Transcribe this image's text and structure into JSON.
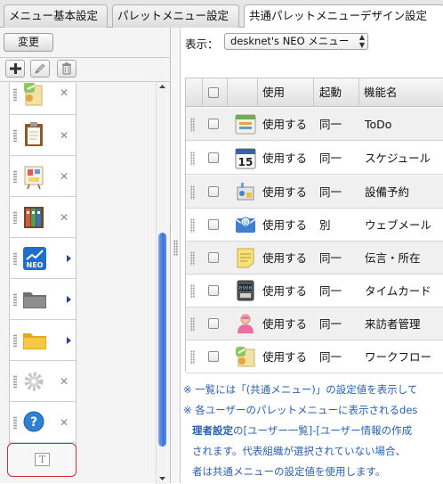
{
  "tabs": [
    {
      "label": "メニュー基本設定",
      "active": false
    },
    {
      "label": "パレットメニュー設定",
      "active": false
    },
    {
      "label": "共通パレットメニューデザイン設定",
      "active": true
    }
  ],
  "left_panel": {
    "change_button": "変更",
    "toolbar_icons": [
      "plus-icon",
      "pencil-icon",
      "trash-icon"
    ],
    "menu_items": [
      {
        "icon": "workflow-icon",
        "trailing": "close"
      },
      {
        "icon": "clipboard-icon",
        "trailing": "close"
      },
      {
        "icon": "bulletin-board-icon",
        "trailing": "close"
      },
      {
        "icon": "binders-icon",
        "trailing": "close"
      },
      {
        "icon": "neo-chart-icon",
        "trailing": "submenu-arrow"
      },
      {
        "icon": "gray-folder-icon",
        "trailing": "submenu-arrow"
      },
      {
        "icon": "yellow-folder-icon",
        "trailing": "submenu-arrow"
      },
      {
        "icon": "gear-icon",
        "trailing": "close"
      },
      {
        "icon": "help-icon",
        "trailing": "close"
      }
    ],
    "text_item_icon": "T"
  },
  "display": {
    "label": "表示：",
    "selected": "desknet's NEO メニュー"
  },
  "table": {
    "headers": {
      "use": "使用",
      "launch": "起動",
      "name": "機能名"
    },
    "rows": [
      {
        "icon": "todo-icon",
        "use": "使用する",
        "launch": "同一",
        "name": "ToDo"
      },
      {
        "icon": "calendar-icon",
        "use": "使用する",
        "launch": "同一",
        "name": "スケジュール"
      },
      {
        "icon": "facility-icon",
        "use": "使用する",
        "launch": "同一",
        "name": "設備予約"
      },
      {
        "icon": "webmail-icon",
        "use": "使用する",
        "launch": "別",
        "name": "ウェブメール"
      },
      {
        "icon": "memo-icon",
        "use": "使用する",
        "launch": "同一",
        "name": "伝言・所在"
      },
      {
        "icon": "timecard-icon",
        "use": "使用する",
        "launch": "同一",
        "name": "タイムカード"
      },
      {
        "icon": "visitor-icon",
        "use": "使用する",
        "launch": "同一",
        "name": "来訪者管理"
      },
      {
        "icon": "workflow-icon",
        "use": "使用する",
        "launch": "同一",
        "name": "ワークフロー"
      }
    ]
  },
  "notes": {
    "line1": "※ 一覧には「(共通メニュー)」の設定値を表示して",
    "line2": "※ 各ユーザーのパレットメニューに表示されるdes",
    "line3_bold": "理者設定",
    "line3_rest": "の[ユーザー一覧]-[ユーザー情報の作成",
    "line4": "されます。代表組織が選択されていない場合、",
    "line5": "者は共通メニューの設定値を使用します。"
  },
  "colors": {
    "accent_blue": "#3d73d6",
    "highlight_red": "#c8323a",
    "note_text": "#2b5fae"
  }
}
